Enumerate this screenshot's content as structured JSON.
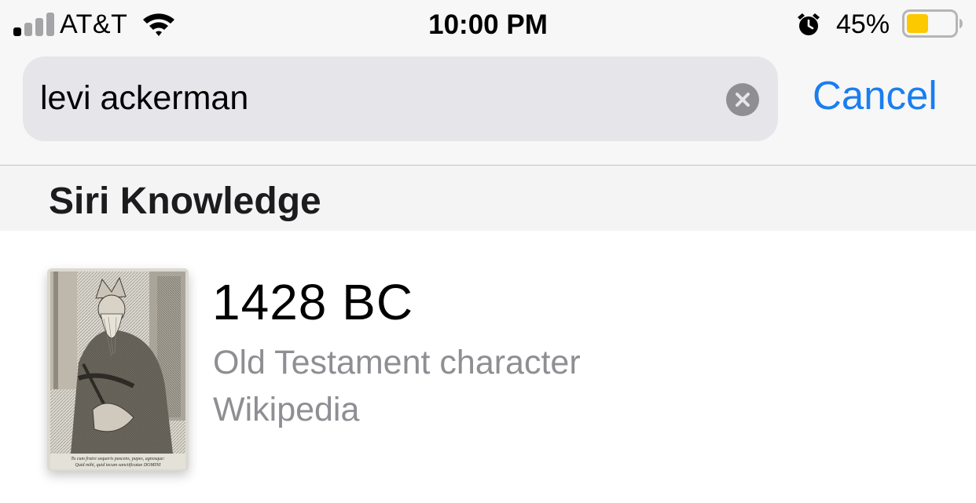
{
  "status_bar": {
    "carrier": "AT&T",
    "time": "10:00 PM",
    "battery_percent": "45%",
    "battery_level": 0.45,
    "signal_bars_active": 1,
    "signal_bars_total": 4,
    "icons": [
      "signal-icon",
      "wifi-icon",
      "alarm-icon",
      "battery-icon"
    ]
  },
  "search": {
    "query": "levi ackerman",
    "clear_icon": "clear-circle-icon",
    "cancel_label": "Cancel"
  },
  "section": {
    "title": "Siri Knowledge"
  },
  "result": {
    "title": "1428 BC",
    "subtitle": "Old Testament character",
    "source": "Wikipedia",
    "thumbnail": {
      "caption_line1": "Tu cum fratre sequeris pascens, pupes, agnosque:",
      "caption_line2": "Quid mihi, quid tecum sanctificatae DOMINI"
    }
  },
  "colors": {
    "accent": "#1a7ef0",
    "secondary_text": "#8e8e93",
    "search_field_bg": "#e5e5ea",
    "battery_fill": "#fcc800"
  }
}
